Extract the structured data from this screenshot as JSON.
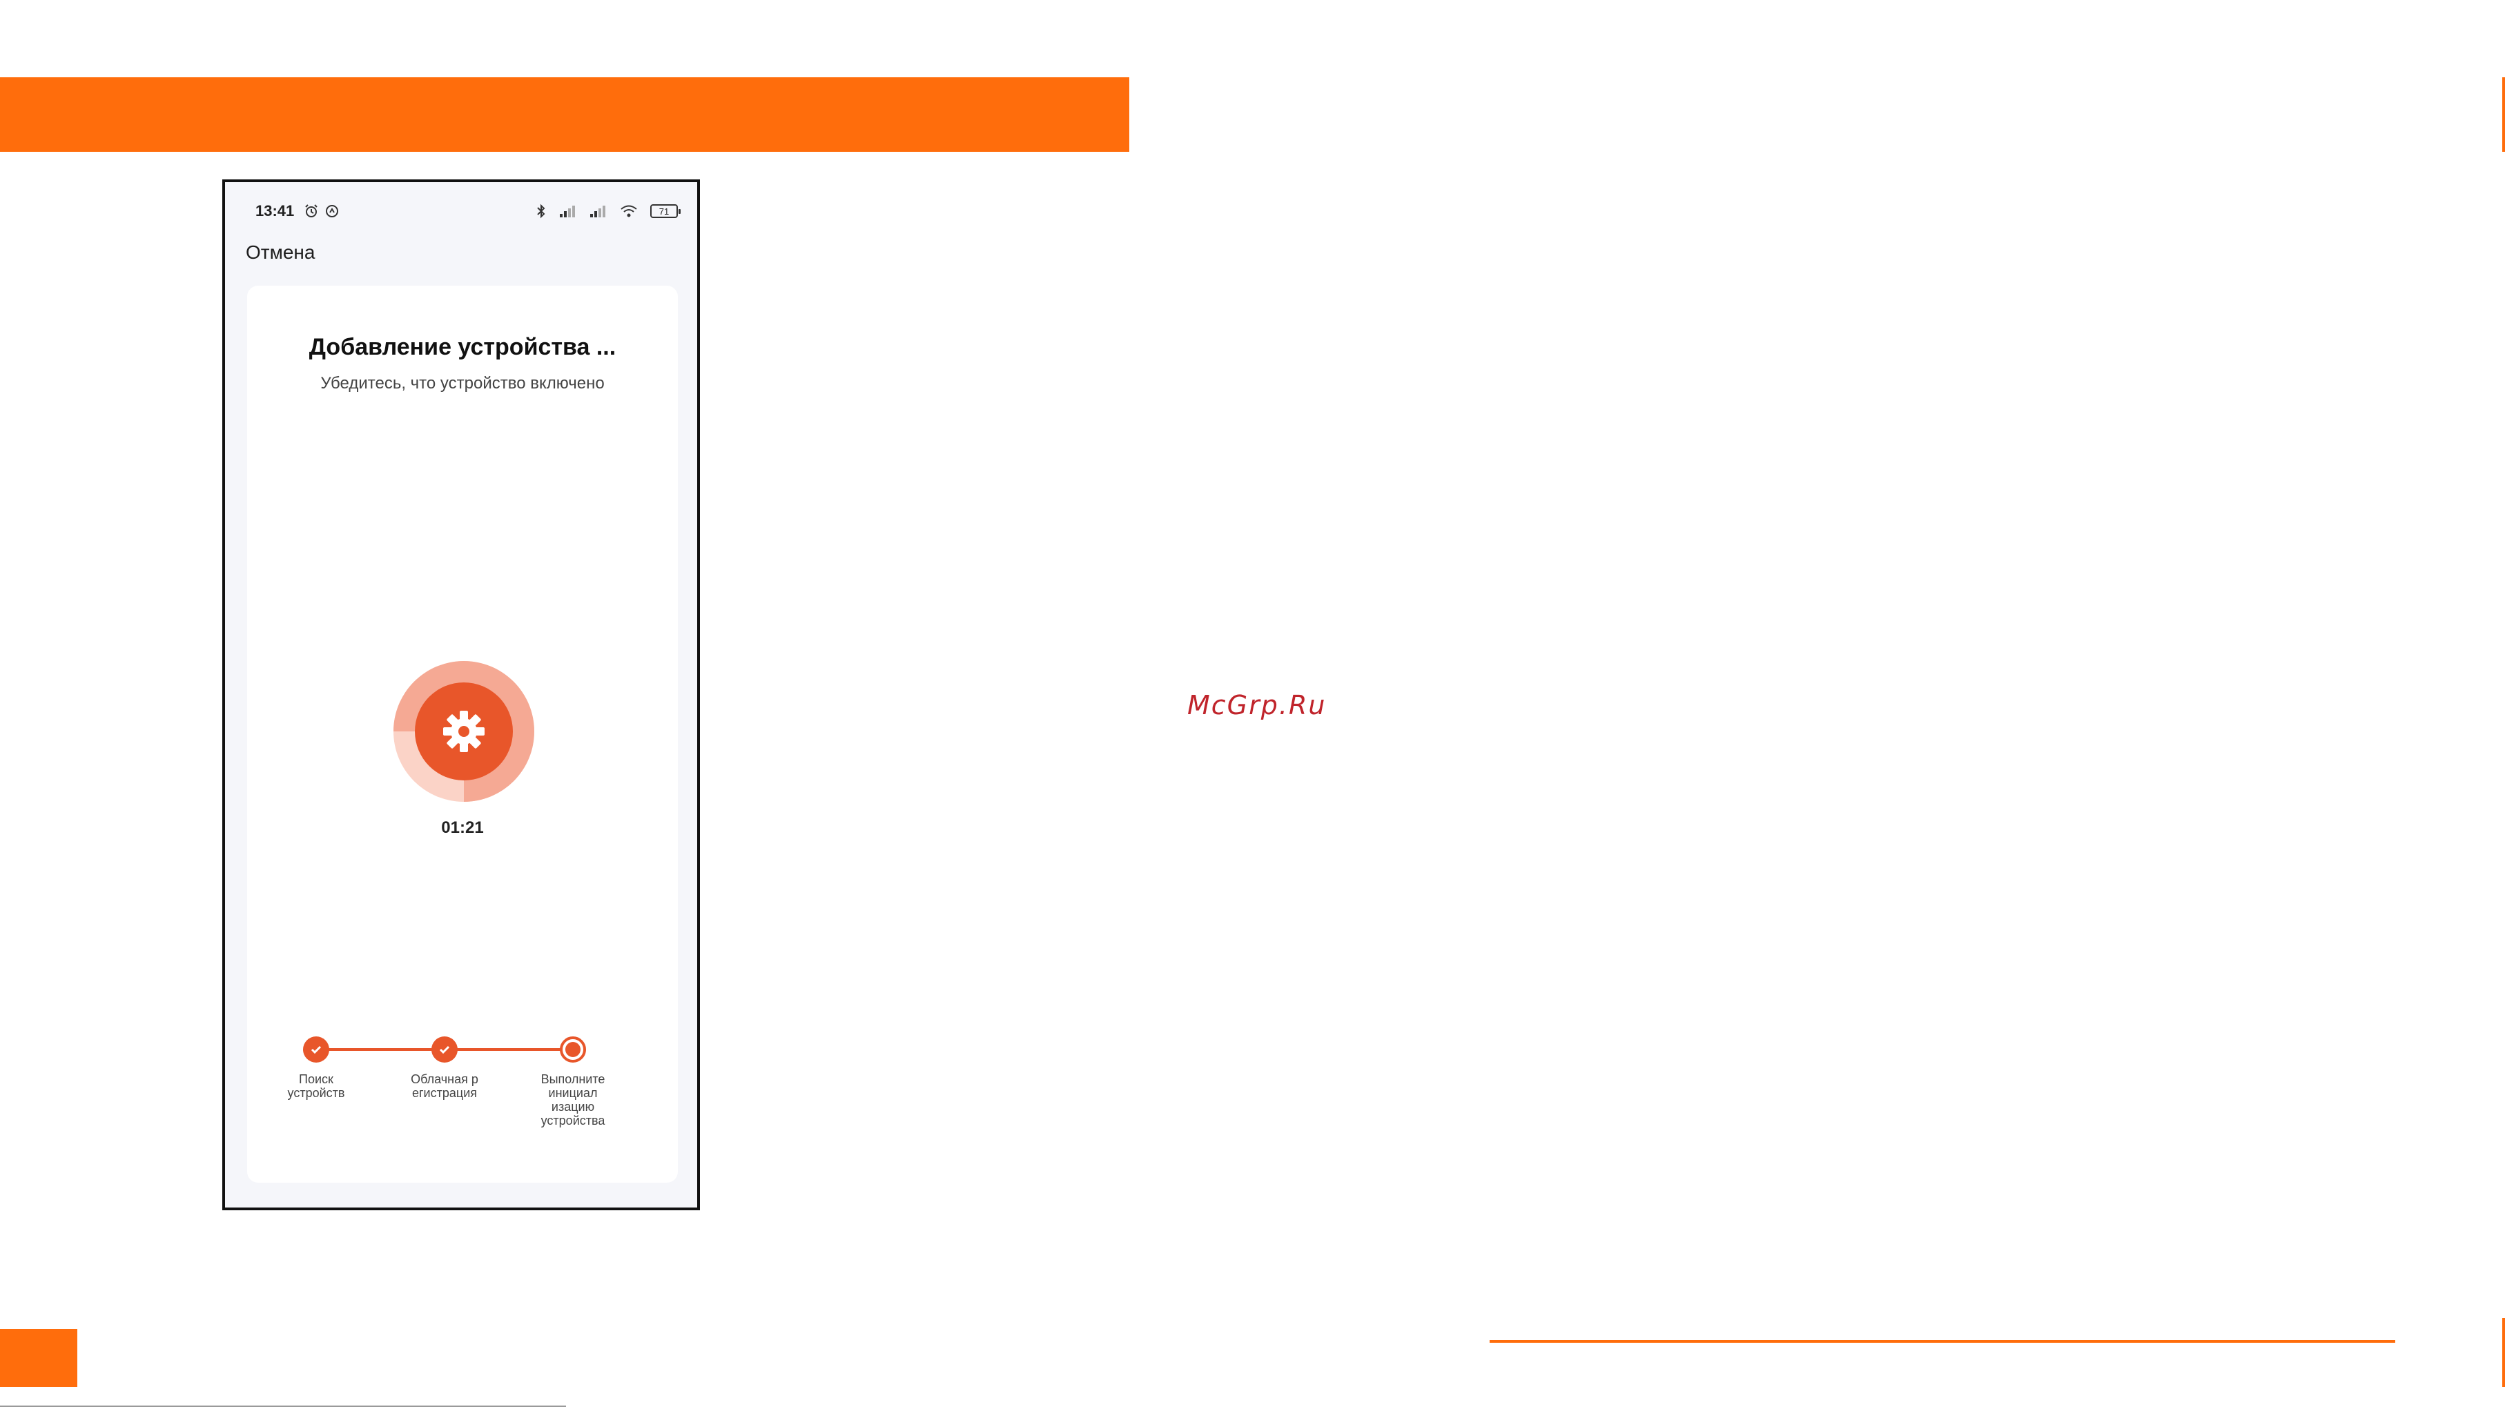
{
  "watermark": "McGrp.Ru",
  "colors": {
    "brand": "#ff6d0c",
    "accent": "#e8562a",
    "ring_light": "#f5a994",
    "ring_pale": "#fbd3c7",
    "watermark": "#c0242b"
  },
  "phone": {
    "status_bar": {
      "time": "13:41",
      "icons_left": [
        "alarm-icon",
        "sync-icon"
      ],
      "icons_right": [
        "bluetooth-icon",
        "signal-icon",
        "signal-icon",
        "wifi-icon"
      ],
      "battery": "71"
    },
    "cancel_label": "Отмена",
    "card": {
      "title": "Добавление устройства ...",
      "subtitle": "Убедитесь, что устройство включено",
      "center_icon": "gear-icon",
      "progress": 0.75,
      "timer": "01:21"
    },
    "steps": [
      {
        "label": "Поиск\nустройств",
        "state": "done"
      },
      {
        "label": "Облачная р\nегистрация",
        "state": "done"
      },
      {
        "label": "Выполните\nинициал\nизацию\nустройства",
        "state": "current"
      }
    ]
  }
}
